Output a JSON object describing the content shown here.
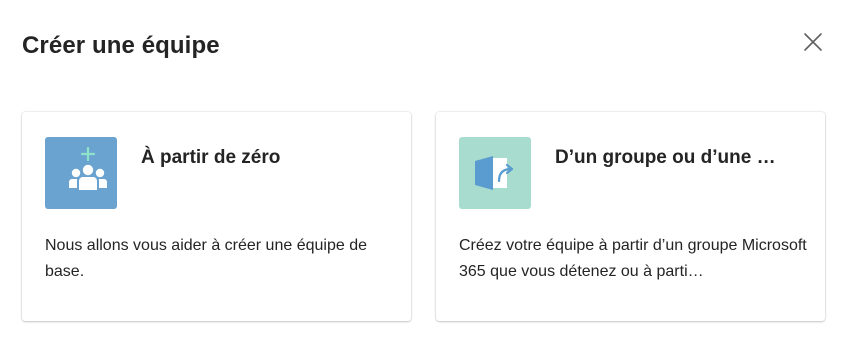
{
  "dialog": {
    "title": "Créer une équipe",
    "close_icon": "close-icon"
  },
  "cards": [
    {
      "title": "À partir de zéro",
      "description": "Nous allons vous aider à créer une équipe de base.",
      "icon": "people-add-icon",
      "icon_bg": "#6aa3cf",
      "icon_accent": "#8fe3c9"
    },
    {
      "title": "D’un groupe ou d’une …",
      "description": "Créez votre équipe à partir d’un groupe Microsoft 365 que vous détenez ou à parti…",
      "icon": "group-import-icon",
      "icon_bg": "#a8dccf",
      "icon_accent": "#5a9bd0"
    }
  ]
}
